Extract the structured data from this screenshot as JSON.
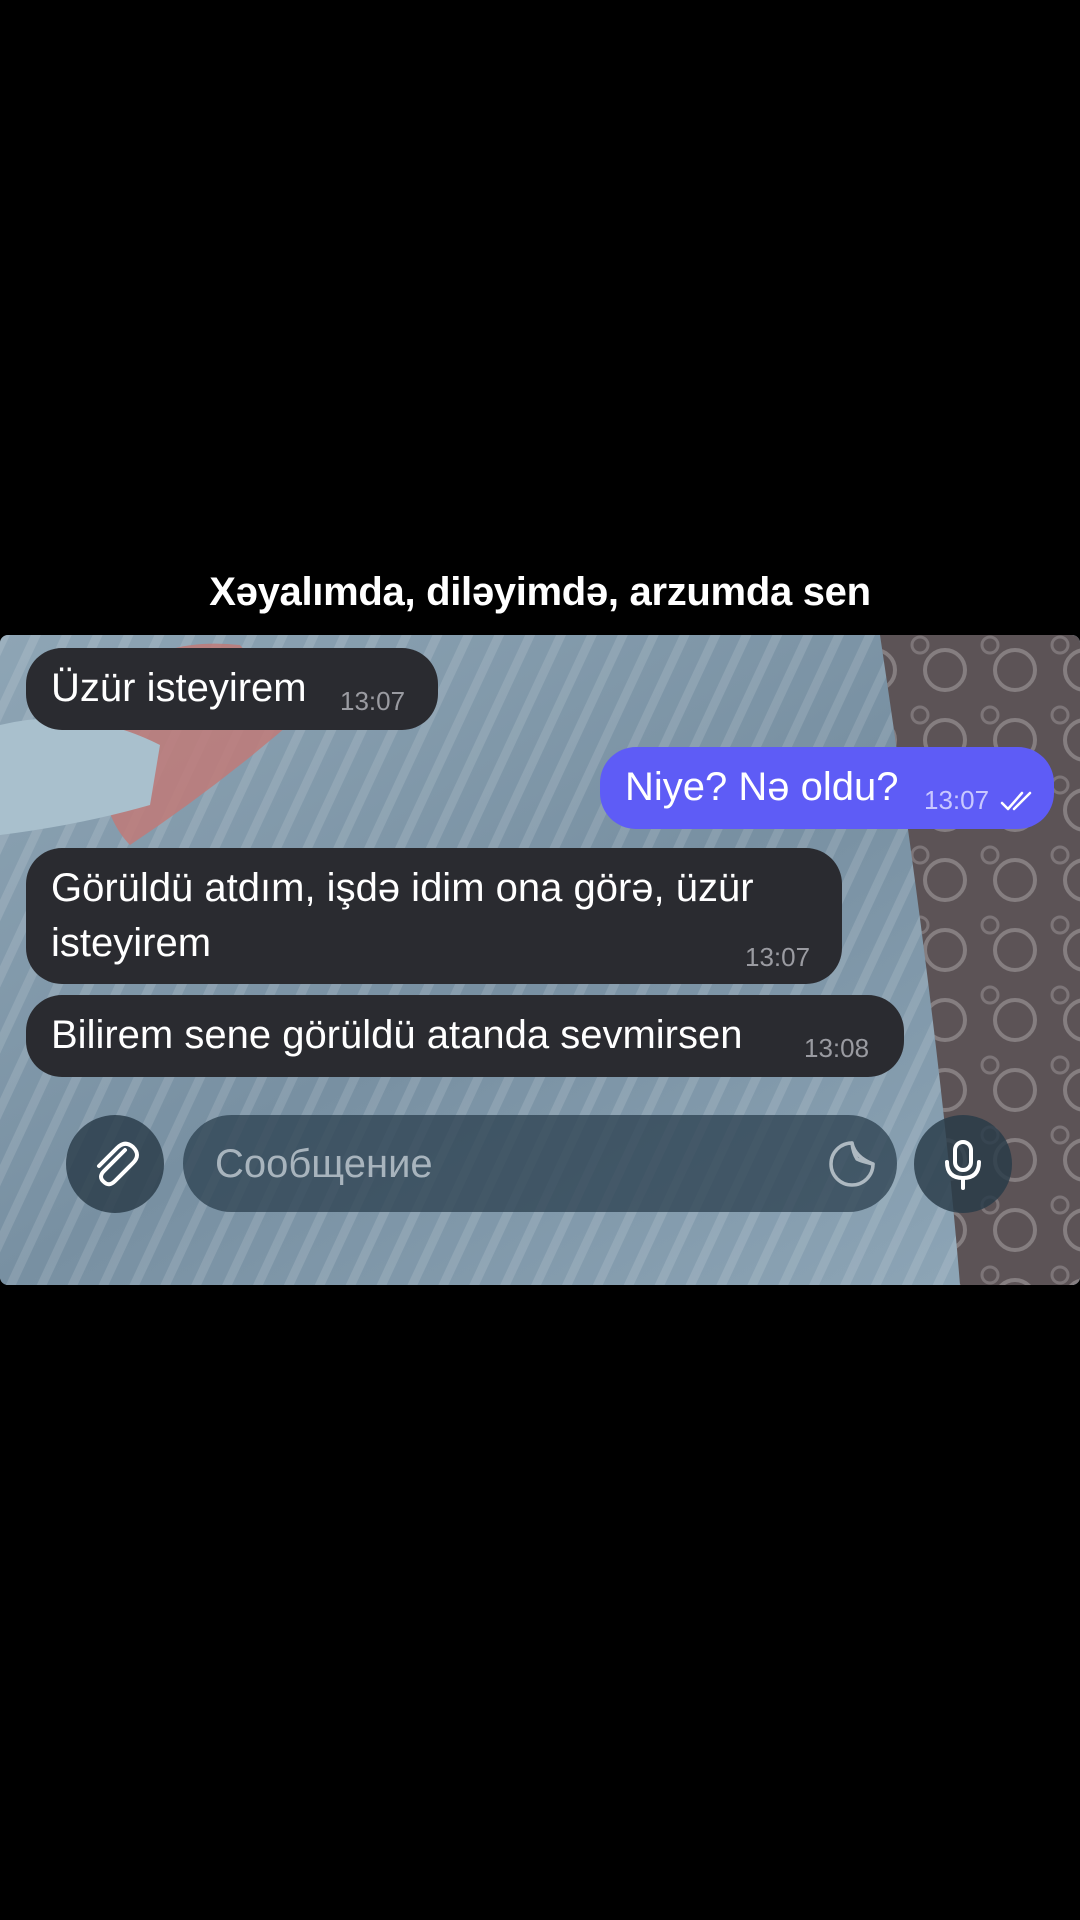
{
  "caption": "Xəyalımda, diləyimdə, arzumda sen",
  "messages": [
    {
      "direction": "incoming",
      "text": "Üzür isteyirem",
      "time": "13:07"
    },
    {
      "direction": "outgoing",
      "text": "Niye? Nə oldu?",
      "time": "13:07",
      "status": "read-double-check"
    },
    {
      "direction": "incoming",
      "text_line1": "Görüldü atdım, işdə idim ona görə, üzür",
      "text_line2": "isteyirem",
      "time": "13:07"
    },
    {
      "direction": "incoming",
      "text": "Bilirem sene görüldü atanda sevmirsen",
      "time": "13:08"
    }
  ],
  "composer": {
    "placeholder": "Сообщение",
    "attach_icon": "paperclip-icon",
    "sticker_icon": "sticker-icon",
    "mic_icon": "microphone-icon"
  },
  "colors": {
    "incoming_bubble": "#2a2b30",
    "outgoing_bubble": "#5e5cf6",
    "background": "#000000"
  }
}
